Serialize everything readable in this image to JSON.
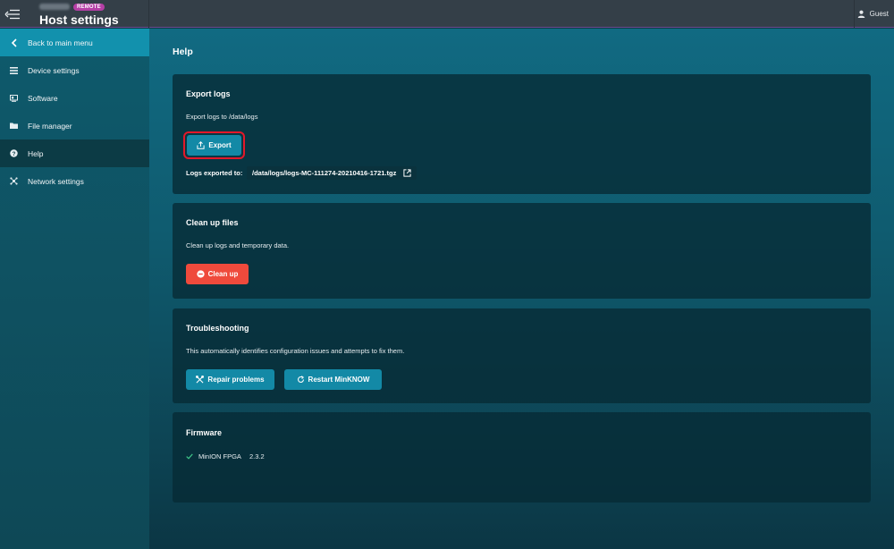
{
  "header": {
    "badge": "REMOTE",
    "title": "Host settings",
    "user": "Guest"
  },
  "sidebar": {
    "items": [
      {
        "label": "Back to main menu",
        "icon": "chevron-left-icon"
      },
      {
        "label": "Device settings",
        "icon": "list-icon"
      },
      {
        "label": "Software",
        "icon": "software-icon"
      },
      {
        "label": "File manager",
        "icon": "folder-icon"
      },
      {
        "label": "Help",
        "icon": "help-circle-icon"
      },
      {
        "label": "Network settings",
        "icon": "network-icon"
      }
    ],
    "active": "Help"
  },
  "main": {
    "title": "Help",
    "export": {
      "title": "Export logs",
      "description": "Export logs to /data/logs",
      "button": "Export",
      "result_label": "Logs exported to:",
      "result_path": "/data/logs/logs-MC-111274-20210416-1721.tgz"
    },
    "cleanup": {
      "title": "Clean up files",
      "description": "Clean up logs and temporary data.",
      "button": "Clean up"
    },
    "troubleshooting": {
      "title": "Troubleshooting",
      "description": "This automatically identifies configuration issues and attempts to fix them.",
      "repair_button": "Repair problems",
      "restart_button": "Restart MinKNOW"
    },
    "firmware": {
      "title": "Firmware",
      "items": [
        {
          "name": "MinION FPGA",
          "version": "2.3.2"
        }
      ]
    }
  },
  "colors": {
    "accent": "#1389a6",
    "danger": "#ef4a3c",
    "badge": "#b53fa6",
    "highlight": "#e3182a"
  }
}
